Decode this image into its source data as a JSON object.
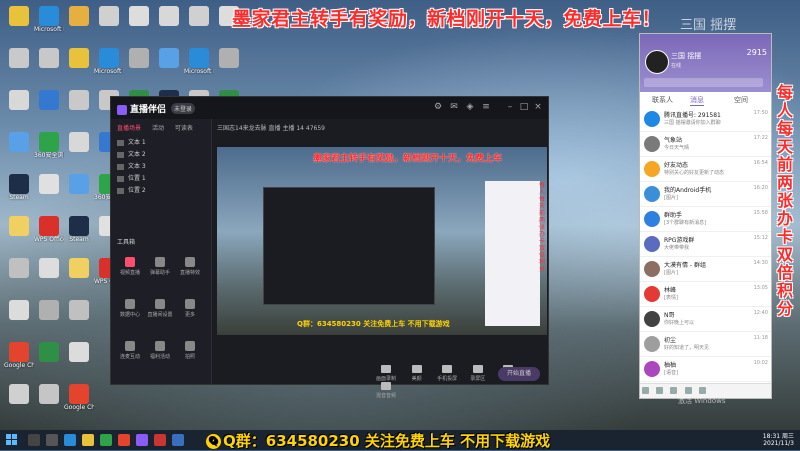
{
  "banner_top": "墨家君主转手有奖励，新档刚开十天，免费上车！",
  "banner_bottom": "Q群：634580230 关注免费上车 不用下载游戏",
  "side_text": "每人每天前两张办卡双倍积分",
  "cam_overlay": "三国 揺摆",
  "desktop_icons": [
    {
      "label": "",
      "color": "#e8c23a"
    },
    {
      "label": "",
      "color": "#c9c9c9"
    },
    {
      "label": "",
      "color": "#d8d8d8"
    },
    {
      "label": "",
      "color": "#5aa0e6"
    },
    {
      "label": "Steam",
      "color": "#1e2e48"
    },
    {
      "label": "",
      "color": "#f0d060"
    },
    {
      "label": "",
      "color": "#c0c0c0"
    },
    {
      "label": "",
      "color": "#dcdcdc"
    },
    {
      "label": "Google Chrome",
      "color": "#e4432d"
    },
    {
      "label": "",
      "color": "#d0d0d0"
    },
    {
      "label": "Microsoft Edge",
      "color": "#2a8bd8"
    },
    {
      "label": "",
      "color": "#c8c8c8"
    },
    {
      "label": "",
      "color": "#3478cf"
    },
    {
      "label": "360安全浏览器",
      "color": "#2ea34a"
    },
    {
      "label": "",
      "color": "#e0e0e0"
    },
    {
      "label": "WPS Office",
      "color": "#d9302c"
    },
    {
      "label": "",
      "color": "#dddddd"
    },
    {
      "label": "",
      "color": "#b0b0b0"
    },
    {
      "label": "",
      "color": "#2f8f47"
    },
    {
      "label": "",
      "color": "#c5c5c5"
    },
    {
      "label": "",
      "color": "#e5b040"
    }
  ],
  "app": {
    "name": "直播伴侣",
    "badge": "未登录",
    "tabs": [
      "直播场景",
      "活动",
      "可读表"
    ],
    "scenes": [
      "文本 1",
      "文本 2",
      "文本 3",
      "位置 1",
      "位置 2"
    ],
    "tools_title": "工具箱",
    "tools": [
      "视频直播",
      "弹幕助手",
      "直播特效",
      "数据中心",
      "直播间设置",
      "更多",
      "连麦互动",
      "福利活动",
      "拍照"
    ],
    "info": "三国志14来龙去脉    直播    主播    14  47659",
    "bottom_tools": [
      "画面录制",
      "美颜",
      "手机投屏",
      "录屏区",
      "音效",
      "混音音频"
    ],
    "go_live": "开始直播"
  },
  "preview": {
    "banner": "墨家君主转手有奖励，新档刚开十天，免费上车",
    "bottom": "Q群：634580230 关注免费上车 不用下载游戏",
    "side": "每人每天前两张办卡双倍积分"
  },
  "qq": {
    "name": "三国 揺摆",
    "count": "2915",
    "status": "在线",
    "tabs": [
      "消息",
      "联系人",
      "空间"
    ],
    "contacts": [
      {
        "name": "腾讯直播号: 291581",
        "msg": "三国 揺摆邀请你加入群聊",
        "time": "17:50",
        "color": "#1e88e5"
      },
      {
        "name": "气象站",
        "msg": "今日天气晴",
        "time": "17:22",
        "color": "#7a7a7a"
      },
      {
        "name": "好友动态",
        "msg": "特别关心的好友更新了动态",
        "time": "16:54",
        "color": "#f5a623"
      },
      {
        "name": "我的Android手机",
        "msg": "[图片]",
        "time": "16:20",
        "color": "#3a8fd8"
      },
      {
        "name": "群助手",
        "msg": "[3个群聊有新消息]",
        "time": "15:58",
        "color": "#2d7fe0"
      },
      {
        "name": "RPG游戏群",
        "msg": "大佬带带我",
        "time": "15:12",
        "color": "#5b6bbf"
      },
      {
        "name": "大漠有情 - 群组",
        "msg": "[图片]",
        "time": "14:30",
        "color": "#8d6e63"
      },
      {
        "name": "林峰",
        "msg": "[表情]",
        "time": "13:05",
        "color": "#e53935"
      },
      {
        "name": "N哥",
        "msg": "你好晚上可以",
        "time": "12:40",
        "color": "#424242"
      },
      {
        "name": "初尘",
        "msg": "好的知道了，明天见",
        "time": "11:18",
        "color": "#9e9e9e"
      },
      {
        "name": "柚柚",
        "msg": "[语音]",
        "time": "10:02",
        "color": "#ab47bc"
      }
    ]
  },
  "taskbar": {
    "time": "18:31 周三",
    "date": "2021/11/3"
  },
  "watermark": "激活 Windows"
}
